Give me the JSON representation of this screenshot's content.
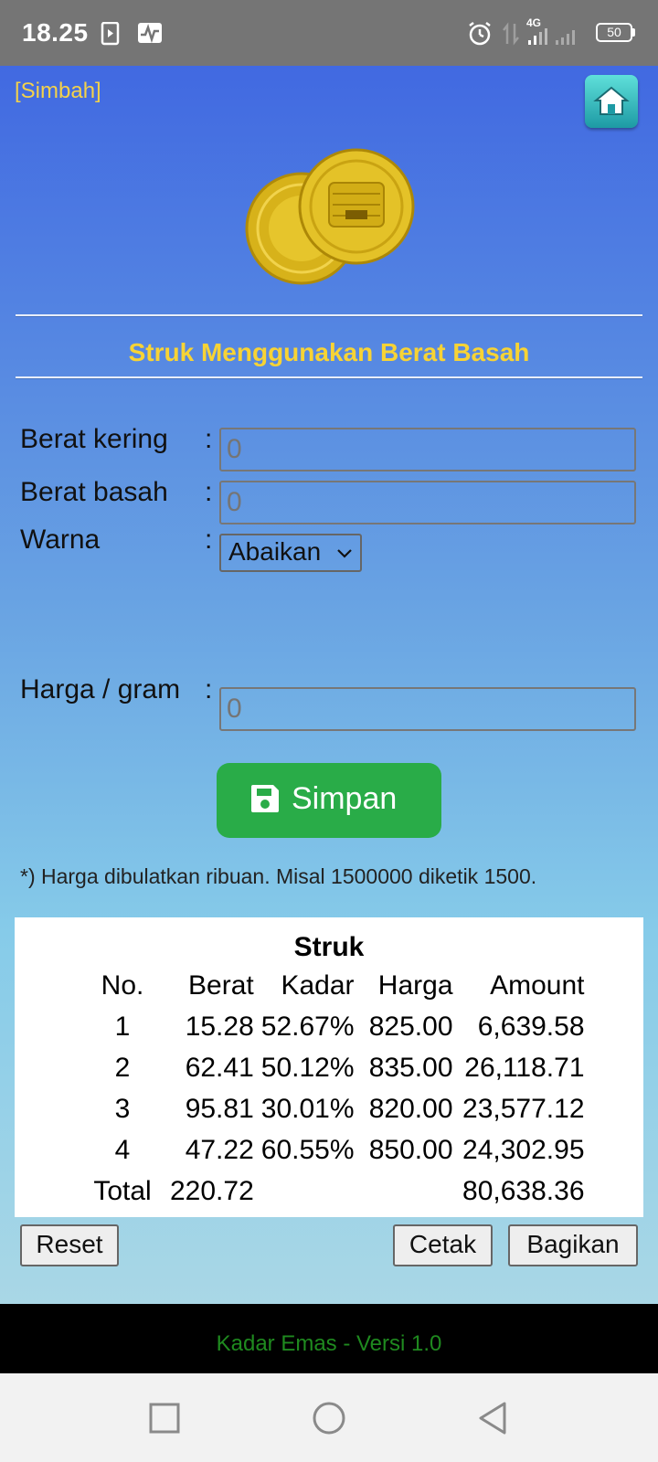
{
  "status": {
    "time": "18.25",
    "network": "4G",
    "battery": "50"
  },
  "header": {
    "label": "[Simbah]",
    "home_icon": "home-icon"
  },
  "title": "Struk Menggunakan Berat Basah",
  "form": {
    "berat_kering": {
      "label": "Berat kering",
      "placeholder": "0"
    },
    "berat_basah": {
      "label": "Berat basah",
      "placeholder": "0"
    },
    "warna": {
      "label": "Warna",
      "value": "Abaikan"
    },
    "harga": {
      "label": "Harga / gram",
      "placeholder": "0"
    },
    "colon": ":"
  },
  "simpan_label": "Simpan",
  "note": "*) Harga dibulatkan ribuan. Misal 1500000 diketik 1500.",
  "struk": {
    "title": "Struk",
    "headers": [
      "No.",
      "Berat",
      "Kadar",
      "Harga",
      "Amount"
    ],
    "rows": [
      [
        "1",
        "15.28",
        "52.67%",
        "825.00",
        "6,639.58"
      ],
      [
        "2",
        "62.41",
        "50.12%",
        "835.00",
        "26,118.71"
      ],
      [
        "3",
        "95.81",
        "30.01%",
        "820.00",
        "23,577.12"
      ],
      [
        "4",
        "47.22",
        "60.55%",
        "850.00",
        "24,302.95"
      ]
    ],
    "total": {
      "label": "Total",
      "berat": "220.72",
      "amount": "80,638.36"
    }
  },
  "buttons": {
    "reset": "Reset",
    "cetak": "Cetak",
    "bagikan": "Bagikan"
  },
  "footer": "Kadar Emas - Versi 1.0",
  "colors": {
    "accent": "#f7d335",
    "simpan": "#29ac48",
    "footer_text": "#1f8a1f"
  }
}
